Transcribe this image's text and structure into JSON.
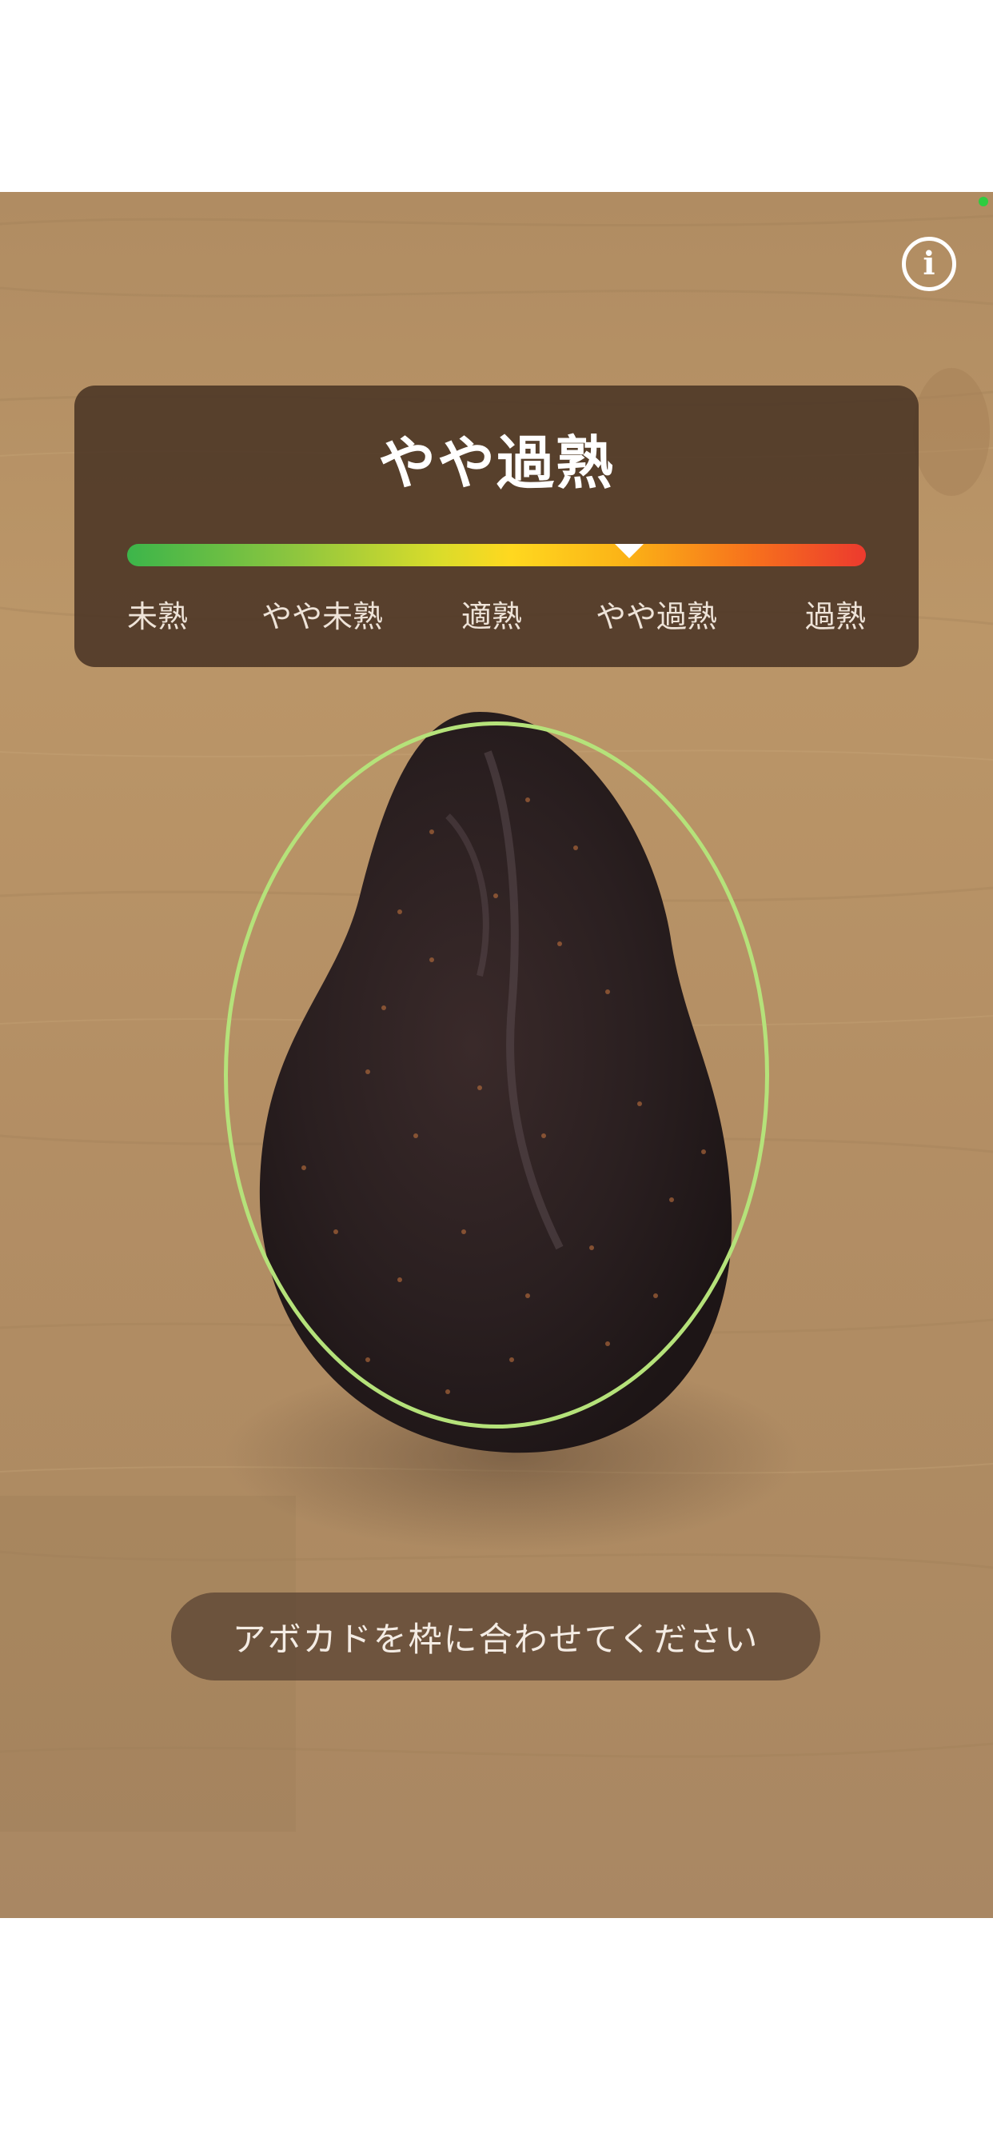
{
  "camera": {
    "status_dot_color": "#2ecc40"
  },
  "info_button": {
    "icon": "info-icon",
    "glyph": "i"
  },
  "ripeness_panel": {
    "status": "やや過熟",
    "scale_labels": [
      "未熟",
      "やや未熟",
      "適熟",
      "やや過熟",
      "過熟"
    ],
    "current_level_index": 3,
    "current_position_fraction": 0.68,
    "scale_colors": [
      "#3cb54a",
      "#ffd81f",
      "#ec3a2e"
    ]
  },
  "alignment_guide": {
    "color": "#b5e27a"
  },
  "hint": {
    "text": "アボカドを枠に合わせてください"
  }
}
